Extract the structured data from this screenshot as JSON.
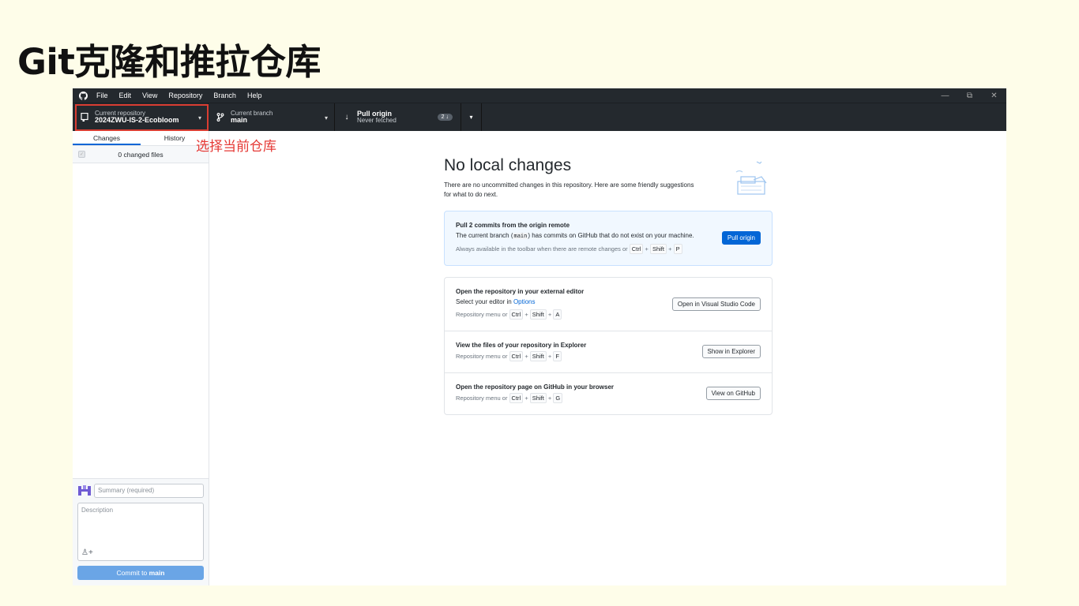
{
  "slide": {
    "title": "Git克隆和推拉仓库"
  },
  "annotation": "选择当前仓库",
  "menu": [
    "File",
    "Edit",
    "View",
    "Repository",
    "Branch",
    "Help"
  ],
  "window_controls": {
    "minimize": "—",
    "restore": "⧉",
    "close": "✕"
  },
  "toolbar": {
    "repo": {
      "label": "Current repository",
      "value": "2024ZWU-IS-2-Ecobloom"
    },
    "branch": {
      "label": "Current branch",
      "value": "main"
    },
    "pull": {
      "label": "Pull origin",
      "sub": "Never fetched",
      "badge": "2 ↓"
    }
  },
  "sidebar": {
    "tabs": [
      "Changes",
      "History"
    ],
    "changed_files": "0 changed files",
    "summary_placeholder": "Summary (required)",
    "description_placeholder": "Description",
    "commit_prefix": "Commit to ",
    "commit_branch": "main"
  },
  "main": {
    "title": "No local changes",
    "description": "There are no uncommitted changes in this repository. Here are some friendly suggestions for what to do next.",
    "pull_card": {
      "heading": "Pull 2 commits from the origin remote",
      "text_before": "The current branch (",
      "text_code": "main",
      "text_after": ") has commits on GitHub that do not exist on your machine.",
      "hint": "Always available in the toolbar when there are remote changes or",
      "keys": [
        "Ctrl",
        "+",
        "Shift",
        "+",
        "P"
      ],
      "button": "Pull origin"
    },
    "editor_card": {
      "heading": "Open the repository in your external editor",
      "text": "Select your editor in ",
      "link": "Options",
      "hint": "Repository menu or",
      "keys": [
        "Ctrl",
        "+",
        "Shift",
        "+",
        "A"
      ],
      "button": "Open in Visual Studio Code"
    },
    "explorer_card": {
      "heading": "View the files of your repository in Explorer",
      "hint": "Repository menu or",
      "keys": [
        "Ctrl",
        "+",
        "Shift",
        "+",
        "F"
      ],
      "button": "Show in Explorer"
    },
    "github_card": {
      "heading": "Open the repository page on GitHub in your browser",
      "hint": "Repository menu or",
      "keys": [
        "Ctrl",
        "+",
        "Shift",
        "+",
        "G"
      ],
      "button": "View on GitHub"
    }
  },
  "colors": {
    "accent": "#0366d6",
    "highlight": "#d93d32",
    "toolbar": "#24292e",
    "slide_bg": "#fefde9"
  }
}
